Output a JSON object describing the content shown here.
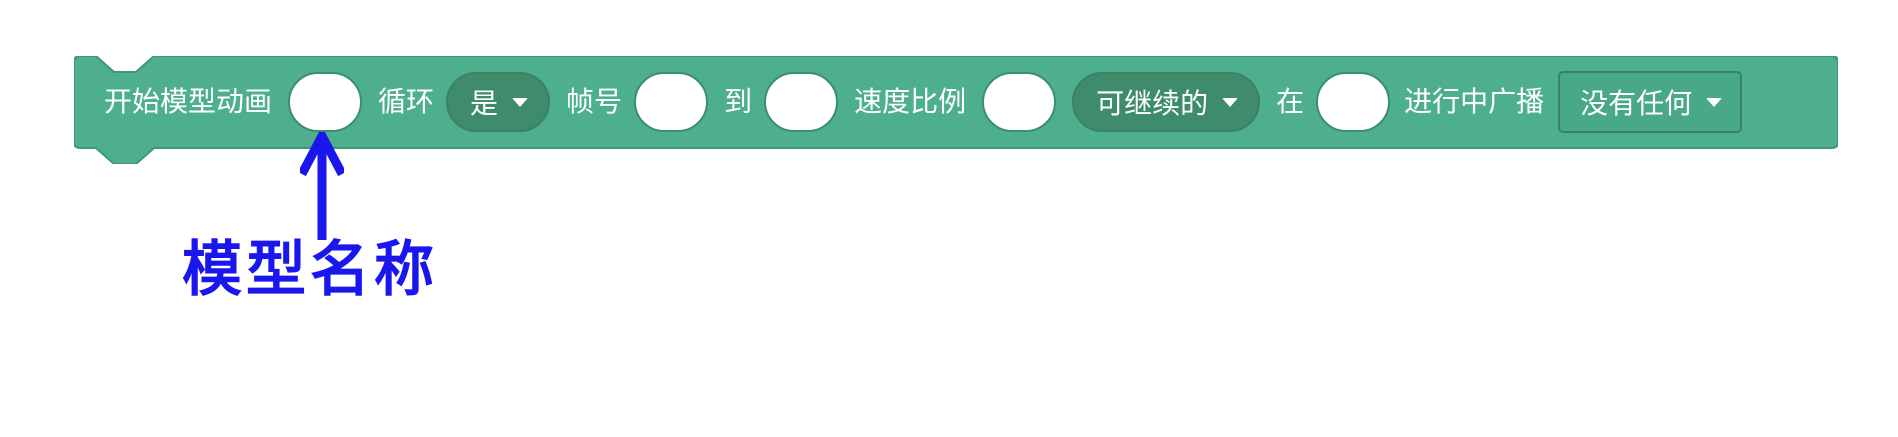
{
  "block": {
    "color": "#4eaf8e",
    "parts": [
      {
        "kind": "label",
        "name": "label-start-model-animation",
        "text": "开始模型动画"
      },
      {
        "kind": "slot",
        "name": "model-name-input"
      },
      {
        "kind": "label",
        "name": "label-loop",
        "text": "循环"
      },
      {
        "kind": "dropdown-round",
        "name": "loop-dropdown",
        "value": "是"
      },
      {
        "kind": "label",
        "name": "label-frame-number",
        "text": "帧号"
      },
      {
        "kind": "slot",
        "name": "start-frame-input"
      },
      {
        "kind": "label",
        "name": "label-to",
        "text": "到"
      },
      {
        "kind": "slot",
        "name": "end-frame-input"
      },
      {
        "kind": "label",
        "name": "label-speed-ratio",
        "text": "速度比例"
      },
      {
        "kind": "slot",
        "name": "speed-ratio-input"
      },
      {
        "kind": "dropdown-round",
        "name": "resumable-dropdown",
        "value": "可继续的"
      },
      {
        "kind": "label",
        "name": "label-at",
        "text": "在"
      },
      {
        "kind": "slot",
        "name": "broadcast-frame-input"
      },
      {
        "kind": "label",
        "name": "label-broadcast-in-progress",
        "text": "进行中广播"
      },
      {
        "kind": "dropdown-square",
        "name": "broadcast-message-dropdown",
        "value": "没有任何"
      }
    ]
  },
  "annotation": {
    "label": "模型名称",
    "color": "#1a16ee",
    "arrow_icon": "arrow-up-icon"
  }
}
